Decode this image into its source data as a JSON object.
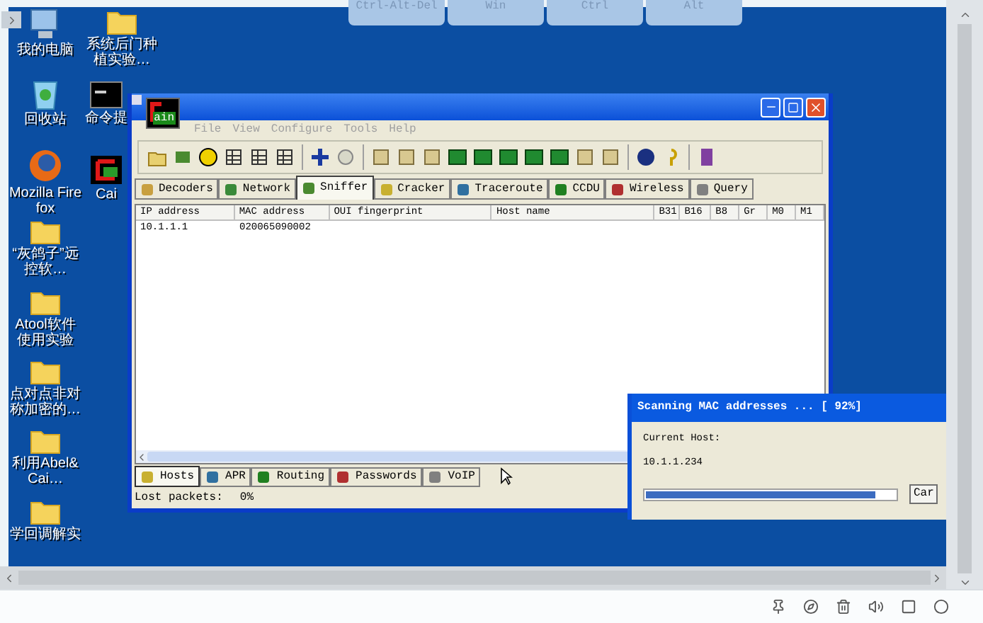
{
  "remote_keys": [
    {
      "label": "Ctrl-Alt-Del"
    },
    {
      "label": "Win"
    },
    {
      "label": "Ctrl"
    },
    {
      "label": "Alt"
    }
  ],
  "desktop_columns": [
    [
      {
        "label": "我的电脑",
        "kind": "computer"
      },
      {
        "label": "回收站",
        "kind": "recycle"
      },
      {
        "label": "Mozilla Firefox",
        "kind": "browser"
      },
      {
        "label": "“灰鸽子”远控软…",
        "kind": "folder"
      },
      {
        "label": "Atool软件使用实验",
        "kind": "folder"
      },
      {
        "label": "点对点非对称加密的…",
        "kind": "folder"
      },
      {
        "label": "利用Abel&Cai…",
        "kind": "folder"
      },
      {
        "label": "学回调解实",
        "kind": "folder"
      }
    ],
    [
      {
        "label": "系统后门种植实验…",
        "kind": "folder"
      },
      {
        "label": "命令提",
        "kind": "console"
      },
      {
        "label": "Cai",
        "kind": "cain"
      }
    ]
  ],
  "cain_window": {
    "logo": "ain",
    "menu": [
      "File",
      "View",
      "Configure",
      "Tools",
      "Help"
    ],
    "tabs": [
      {
        "label": "Decoders",
        "selected": false
      },
      {
        "label": "Network",
        "selected": false
      },
      {
        "label": "Sniffer",
        "selected": true
      },
      {
        "label": "Cracker",
        "selected": false
      },
      {
        "label": "Traceroute",
        "selected": false
      },
      {
        "label": "CCDU",
        "selected": false
      },
      {
        "label": "Wireless",
        "selected": false
      },
      {
        "label": "Query",
        "selected": false
      }
    ],
    "table": {
      "columns": [
        "IP address",
        "MAC address",
        "OUI fingerprint",
        "Host name",
        "B31",
        "B16",
        "B8",
        "Gr",
        "M0",
        "M1"
      ],
      "rows": [
        [
          "10.1.1.1",
          "020065090002"
        ]
      ]
    },
    "bottom_tabs": [
      {
        "label": "Hosts",
        "selected": true
      },
      {
        "label": "APR",
        "selected": false
      },
      {
        "label": "Routing",
        "selected": false
      },
      {
        "label": "Passwords",
        "selected": false
      },
      {
        "label": "VoIP",
        "selected": false
      }
    ],
    "status": {
      "label": "Lost packets:",
      "value": "0%"
    }
  },
  "scan_dialog": {
    "title": "Scanning MAC addresses ... [ 92%]",
    "label": "Current Host:",
    "host": "10.1.1.234",
    "level": 0.92,
    "button": "Car"
  }
}
